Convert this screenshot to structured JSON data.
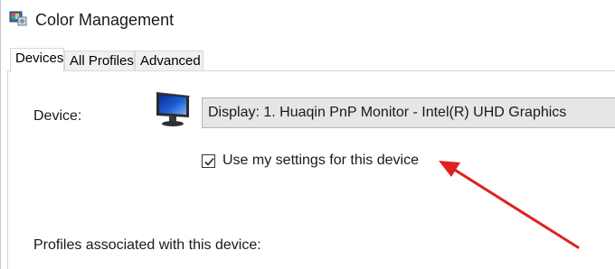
{
  "window": {
    "title": "Color Management",
    "icon": "color-management-icon"
  },
  "tabs": [
    {
      "label": "Devices",
      "active": true
    },
    {
      "label": "All Profiles",
      "active": false
    },
    {
      "label": "Advanced",
      "active": false
    }
  ],
  "devices_tab": {
    "device_label": "Device:",
    "device_icon": "monitor-icon",
    "device_select_value": "Display: 1. Huaqin PnP Monitor - Intel(R) UHD Graphics",
    "use_my_settings_label": "Use my settings for this device",
    "use_my_settings_checked": true,
    "profiles_label": "Profiles associated with this device:"
  },
  "annotation": {
    "arrow_color": "#e02020",
    "arrow_icon": "red-arrow-annotation"
  }
}
